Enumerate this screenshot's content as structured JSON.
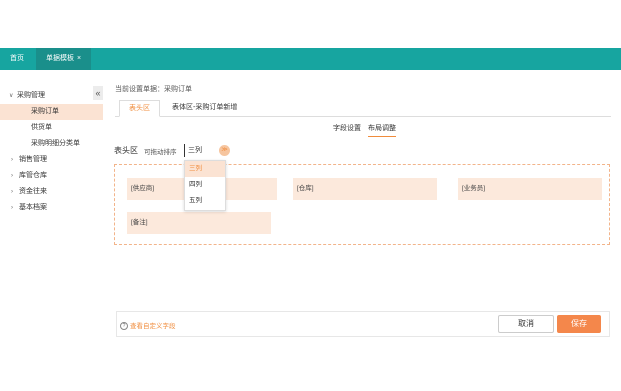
{
  "topnav": {
    "home_label": "首页",
    "active_tab_label": "单据模板",
    "close_symbol": "×"
  },
  "sidebar": {
    "collapse_symbol": "«",
    "items": [
      {
        "label": "采购管理",
        "caret": "∨"
      },
      {
        "label": "采购订单"
      },
      {
        "label": "供货单"
      },
      {
        "label": "采购明细分类单"
      },
      {
        "label": "销售管理",
        "caret": "›"
      },
      {
        "label": "库管仓库",
        "caret": "›"
      },
      {
        "label": "资金往来",
        "caret": "›"
      },
      {
        "label": "基本档案",
        "caret": "›"
      }
    ]
  },
  "main": {
    "location": "当前设置单据：采购订单",
    "tabs": [
      "表头区",
      "表体区-采购订单新增"
    ],
    "subtabs": [
      "字段设置",
      "布局调整"
    ],
    "section_title": "表头区",
    "sort_label": "可拖动排序",
    "column_select_value": "三列",
    "toggle_symbol": "≫",
    "dropdown_options": [
      "三列",
      "四列",
      "五列"
    ],
    "fields": [
      "[供应商]",
      "[仓库]",
      "[业务员]",
      "[备注]"
    ]
  },
  "footer": {
    "help_icon": "?",
    "custom_fields_link": "查看自定义字段",
    "cancel_label": "取消",
    "save_label": "保存"
  },
  "colors": {
    "topbar": "#17a5a0",
    "accent": "#f08c3c",
    "save_button": "#f4874b",
    "field_bg": "#fce9dc",
    "selected_bg": "#fbe3d3"
  }
}
